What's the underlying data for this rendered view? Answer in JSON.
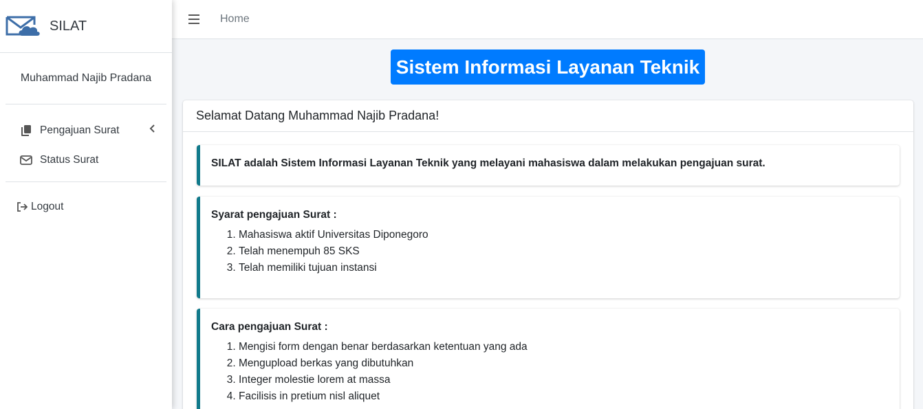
{
  "brand": {
    "name": "SILAT",
    "logo_icon": "mail-cloud-icon"
  },
  "user": {
    "name": "Muhammad Najib Pradana"
  },
  "sidebar": {
    "items": [
      {
        "label": "Pengajuan Surat",
        "icon": "copy-icon",
        "has_submenu": true
      },
      {
        "label": "Status Surat",
        "icon": "envelope-icon"
      }
    ],
    "logout_label": "Logout"
  },
  "topbar": {
    "home_label": "Home"
  },
  "hero": {
    "title": "Sistem Informasi Layanan Teknik",
    "color": "#007bff"
  },
  "card": {
    "title": "Selamat Datang Muhammad Najib Pradana!",
    "intro": "SILAT adalah Sistem Informasi Layanan Teknik yang melayani mahasiswa dalam melakukan pengajuan surat.",
    "requirements": {
      "heading": "Syarat pengajuan Surat :",
      "items": [
        "Mahasiswa aktif Universitas Diponegoro",
        "Telah menempuh 85 SKS",
        "Telah memiliki tujuan instansi"
      ]
    },
    "procedure": {
      "heading": "Cara pengajuan Surat :",
      "items": [
        "Mengisi form dengan benar berdasarkan ketentuan yang ada",
        "Mengupload berkas yang dibutuhkan",
        "Integer molestie lorem at massa",
        "Facilisis in pretium nisl aliquet"
      ]
    }
  },
  "colors": {
    "accent": "#007bff",
    "callout_border": "#117a8b",
    "background": "#f4f6f9"
  }
}
